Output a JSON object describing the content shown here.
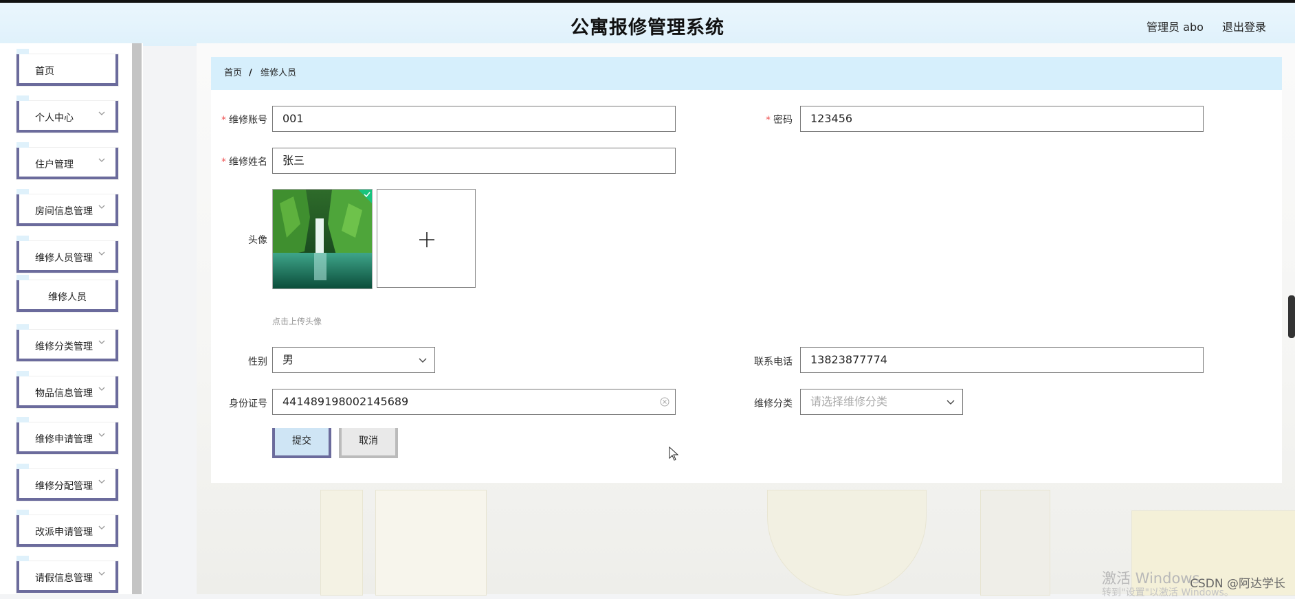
{
  "header": {
    "title": "公寓报修管理系统",
    "user": "管理员 abo",
    "logout": "退出登录"
  },
  "sidebar": {
    "items": [
      {
        "label": "首页",
        "has_children": false
      },
      {
        "label": "个人中心",
        "has_children": true
      },
      {
        "label": "住户管理",
        "has_children": true
      },
      {
        "label": "房间信息管理",
        "has_children": true
      },
      {
        "label": "维修人员管理",
        "has_children": true
      },
      {
        "label": "维修人员",
        "has_children": false
      },
      {
        "label": "维修分类管理",
        "has_children": true
      },
      {
        "label": "物品信息管理",
        "has_children": true
      },
      {
        "label": "维修申请管理",
        "has_children": true
      },
      {
        "label": "维修分配管理",
        "has_children": true
      },
      {
        "label": "改派申请管理",
        "has_children": true
      },
      {
        "label": "请假信息管理",
        "has_children": true
      }
    ]
  },
  "breadcrumb": {
    "home": "首页",
    "separator": "/",
    "current": "维修人员"
  },
  "form": {
    "account": {
      "label": "维修账号",
      "value": "001",
      "required": true
    },
    "password": {
      "label": "密码",
      "value": "123456",
      "required": true
    },
    "name": {
      "label": "维修姓名",
      "value": "张三",
      "required": true
    },
    "avatar": {
      "label": "头像",
      "tip": "点击上传头像"
    },
    "gender": {
      "label": "性别",
      "value": "男"
    },
    "phone": {
      "label": "联系电话",
      "value": "13823877774"
    },
    "id_card": {
      "label": "身份证号",
      "value": "441489198002145689"
    },
    "category": {
      "label": "维修分类",
      "placeholder": "请选择维修分类"
    },
    "required_mark": "*"
  },
  "buttons": {
    "submit": "提交",
    "cancel": "取消"
  },
  "overlay": {
    "activate_windows": "激活 Windows",
    "activate_hint": "转到\"设置\"以激活 Windows。",
    "csdn": "CSDN @阿达学长"
  },
  "colors": {
    "accent": "#6b6b9c",
    "breadcrumb_bg": "#d6effc",
    "header_bg": "#dff1fb",
    "required": "#e55555"
  }
}
